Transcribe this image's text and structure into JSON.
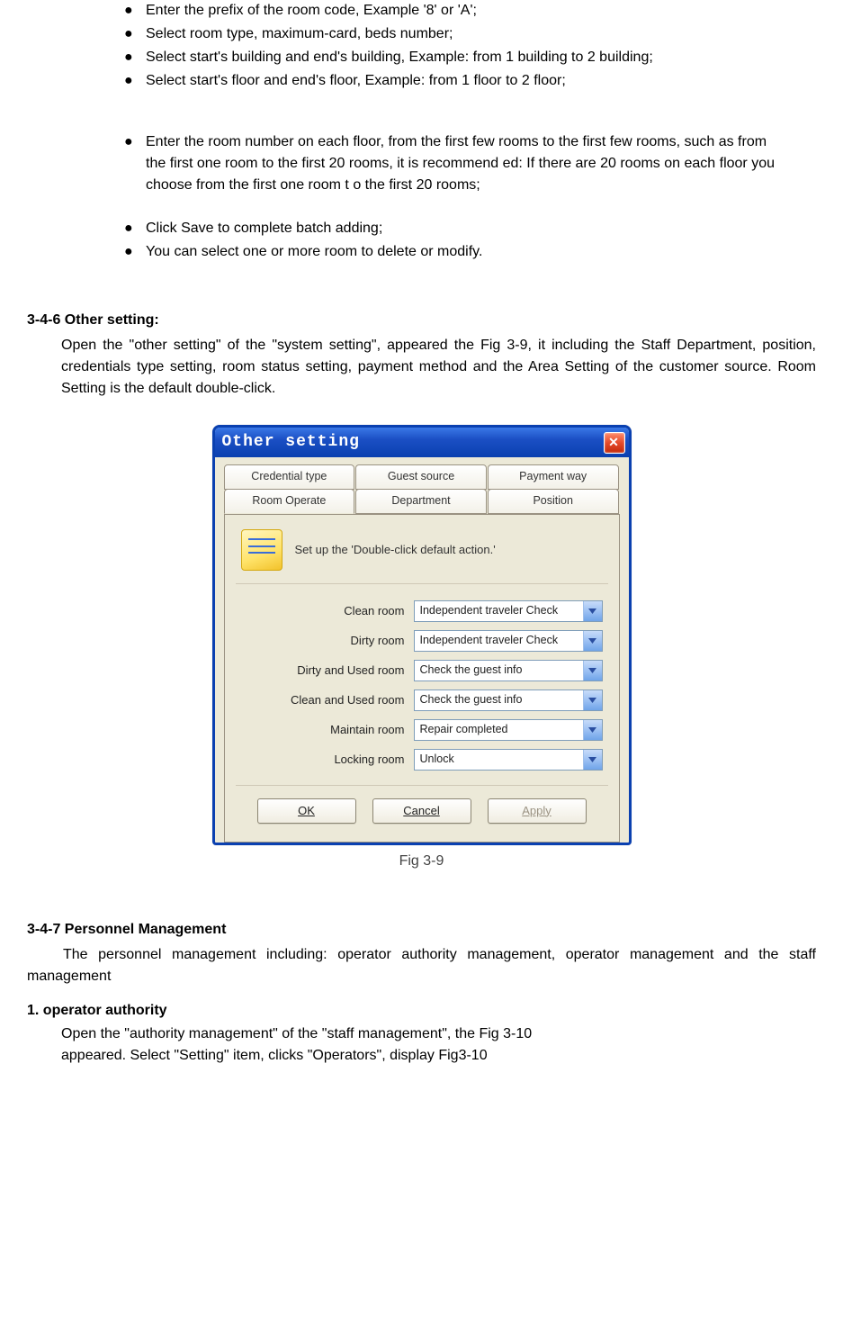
{
  "bullets": {
    "b1": "Enter the prefix of the room code, Example '8' or 'A';",
    "b2": "Select room type, maximum-card, beds number;",
    "b3": "Select start's building and end's building, Example: from 1 building to 2 building;",
    "b4": "Select start's floor and end's floor, Example: from 1 floor to 2 floor;",
    "b5": "Enter the room number on each floor, from the first few rooms to the first few rooms, such as from the first one room to the first 20 rooms, it is recommend ed: If there are 20 rooms on each floor you choose from the first one room t o the first 20 rooms;",
    "b6": "Click Save to complete batch adding;",
    "b7": "You can select one or more room to delete or modify."
  },
  "section346": {
    "heading": "3-4-6 Other setting:",
    "para": "Open the \"other setting\" of the \"system setting\", appeared the Fig 3-9, it including the Staff Department, position, credentials type setting, room status setting, payment method and the Area Setting of the customer source. Room Setting is the default double-click."
  },
  "dialog": {
    "title": "Other setting",
    "tabs_back": {
      "t1": "Credential type",
      "t2": "Guest source",
      "t3": "Payment way"
    },
    "tabs_front": {
      "t1": "Room Operate",
      "t2": "Department",
      "t3": "Position"
    },
    "hint": "Set up the 'Double-click default action.'",
    "rows": {
      "r1": {
        "label": "Clean room",
        "value": "Independent traveler Check"
      },
      "r2": {
        "label": "Dirty room",
        "value": "Independent traveler Check"
      },
      "r3": {
        "label": "Dirty and Used room",
        "value": "Check the guest info"
      },
      "r4": {
        "label": "Clean and Used room",
        "value": "Check the guest info"
      },
      "r5": {
        "label": "Maintain room",
        "value": "Repair completed"
      },
      "r6": {
        "label": "Locking room",
        "value": "Unlock"
      }
    },
    "buttons": {
      "ok": "OK",
      "cancel": "Cancel",
      "apply": "Apply"
    },
    "caption": "Fig 3-9"
  },
  "section347": {
    "heading": "3-4-7 Personnel Management",
    "para": "The personnel management including: operator authority management, operator management and the staff management"
  },
  "num1": {
    "heading": "1.   operator authority",
    "line1": "Open the \"authority management\" of the \"staff management\", the Fig 3-10",
    "line2": "appeared. Select \"Setting\" item, clicks \"Operators\", display Fig3-10"
  }
}
